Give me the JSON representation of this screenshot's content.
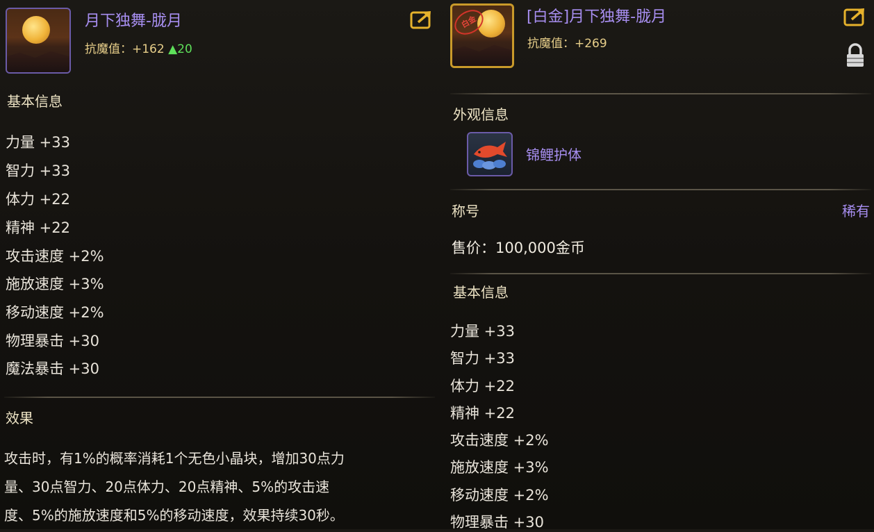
{
  "left": {
    "item_name": "月下独舞-胧月",
    "resist_label": "抗魔值：+162",
    "resist_up": "▲20",
    "basic_info_title": "基本信息",
    "stats": [
      "力量 +33",
      "智力 +33",
      "体力 +22",
      "精神 +22",
      "攻击速度 +2%",
      "施放速度 +3%",
      "移动速度 +2%",
      "物理暴击 +30",
      "魔法暴击 +30"
    ],
    "effect_title": "效果",
    "effect_lines": [
      "攻击时，有1%的概率消耗1个无色小晶块，增加30点力",
      "量、30点智力、20点体力、20点精神、5%的攻击速",
      "度、5%的施放速度和5%的移动速度，效果持续30秒。"
    ]
  },
  "right": {
    "item_name": "[白金]月下独舞-胧月",
    "stamp_text": "白金",
    "resist_label": "抗魔值：+269",
    "appearance_title": "外观信息",
    "appearance_name": "锦鲤护体",
    "title_label": "称号",
    "rarity": "稀有",
    "price": "售价：100,000金币",
    "basic_info_title": "基本信息",
    "stats": [
      "力量 +33",
      "智力 +33",
      "体力 +22",
      "精神 +22",
      "攻击速度 +2%",
      "施放速度 +3%",
      "移动速度 +2%",
      "物理暴击 +30"
    ]
  },
  "icons": {
    "share": "share-icon",
    "lock": "lock-icon"
  },
  "colors": {
    "item_name": "#a78ef0",
    "resist": "#e8cf8a",
    "resist_up": "#5ee05a",
    "platinum_border": "#c99a2a"
  }
}
